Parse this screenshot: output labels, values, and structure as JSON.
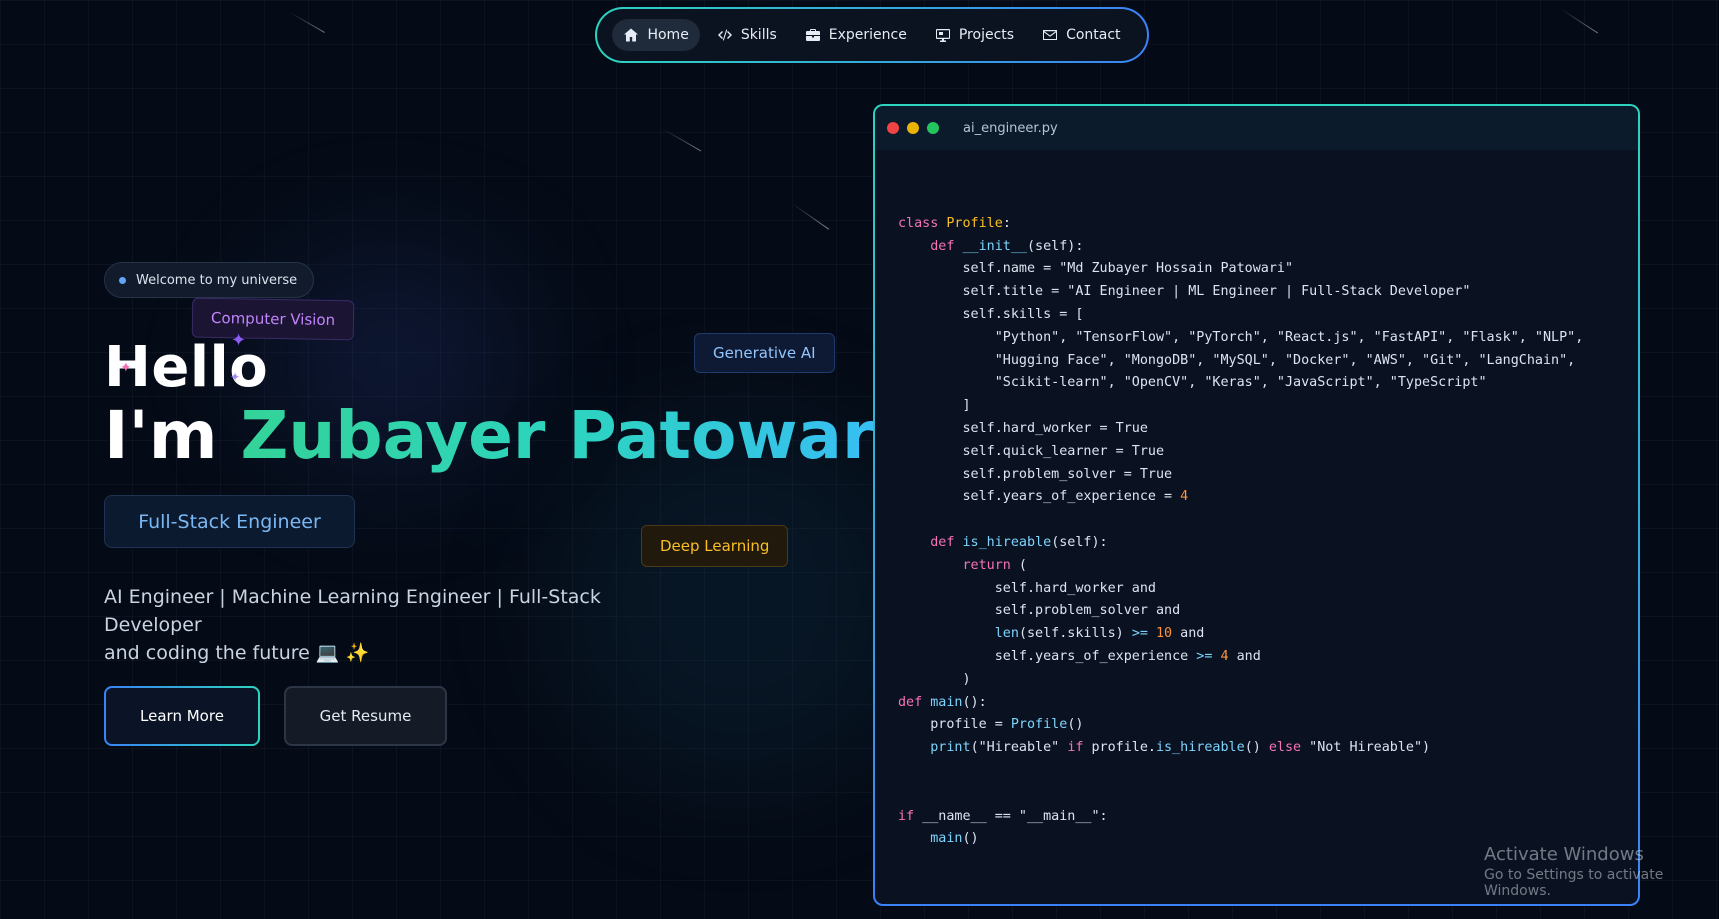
{
  "nav": {
    "items": [
      {
        "label": "Home",
        "icon": "home-icon",
        "active": true
      },
      {
        "label": "Skills",
        "icon": "code-icon"
      },
      {
        "label": "Experience",
        "icon": "briefcase-icon"
      },
      {
        "label": "Projects",
        "icon": "monitor-icon"
      },
      {
        "label": "Contact",
        "icon": "mail-icon"
      }
    ]
  },
  "hero": {
    "welcome": "Welcome to my universe",
    "hello": "Hello",
    "im": "I'm ",
    "name": "Zubayer Patowari",
    "role": "Full-Stack Engineer",
    "desc_line1": "AI Engineer | Machine Learning Engineer | Full-Stack Developer",
    "desc_line2": "and coding the future 💻 ✨",
    "learn_more": "Learn More",
    "get_resume": "Get Resume"
  },
  "chips": {
    "computer_vision": "Computer Vision",
    "generative_ai": "Generative AI",
    "deep_learning": "Deep Learning"
  },
  "code_window": {
    "filename": "ai_engineer.py",
    "lines": [
      "",
      "[[kw:class]] [[cls:Profile]]:",
      "    [[kw:def]] [[fn:__init__]](self):",
      "        self.name = \"Md Zubayer Hossain Patowari\"",
      "        self.title = \"AI Engineer | ML Engineer | Full-Stack Developer\"",
      "        self.skills = [",
      "            \"Python\", \"TensorFlow\", \"PyTorch\", \"React.js\", \"FastAPI\", \"Flask\", \"NLP\",",
      "            \"Hugging Face\", \"MongoDB\", \"MySQL\", \"Docker\", \"AWS\", \"Git\", \"LangChain\",",
      "            \"Scikit-learn\", \"OpenCV\", \"Keras\", \"JavaScript\", \"TypeScript\"",
      "        ]",
      "        self.hard_worker = True",
      "        self.quick_learner = True",
      "        self.problem_solver = True",
      "        self.years_of_experience = [[num:4]]",
      "",
      "    [[kw:def]] [[fn:is_hireable]](self):",
      "        [[kw:return]] (",
      "            self.hard_worker and",
      "            self.problem_solver and",
      "            [[fn:len]](self.skills) [[op:>=]] [[num:10]] and",
      "            self.years_of_experience [[op:>=]] [[num:4]] and",
      "        )",
      "[[kw:def]] [[fn:main]]():",
      "    profile = [[fn:Profile]]()",
      "    [[fn:print]](\"Hireable\" [[kw:if]] profile.[[fn:is_hireable]]() [[kw:else]] \"Not Hireable\")",
      "",
      "",
      "[[kw:if]] __name__ == \"__main__\":",
      "    [[fn:main]]()"
    ]
  },
  "watermark": {
    "title": "Activate Windows",
    "subtitle": "Go to Settings to activate Windows."
  }
}
